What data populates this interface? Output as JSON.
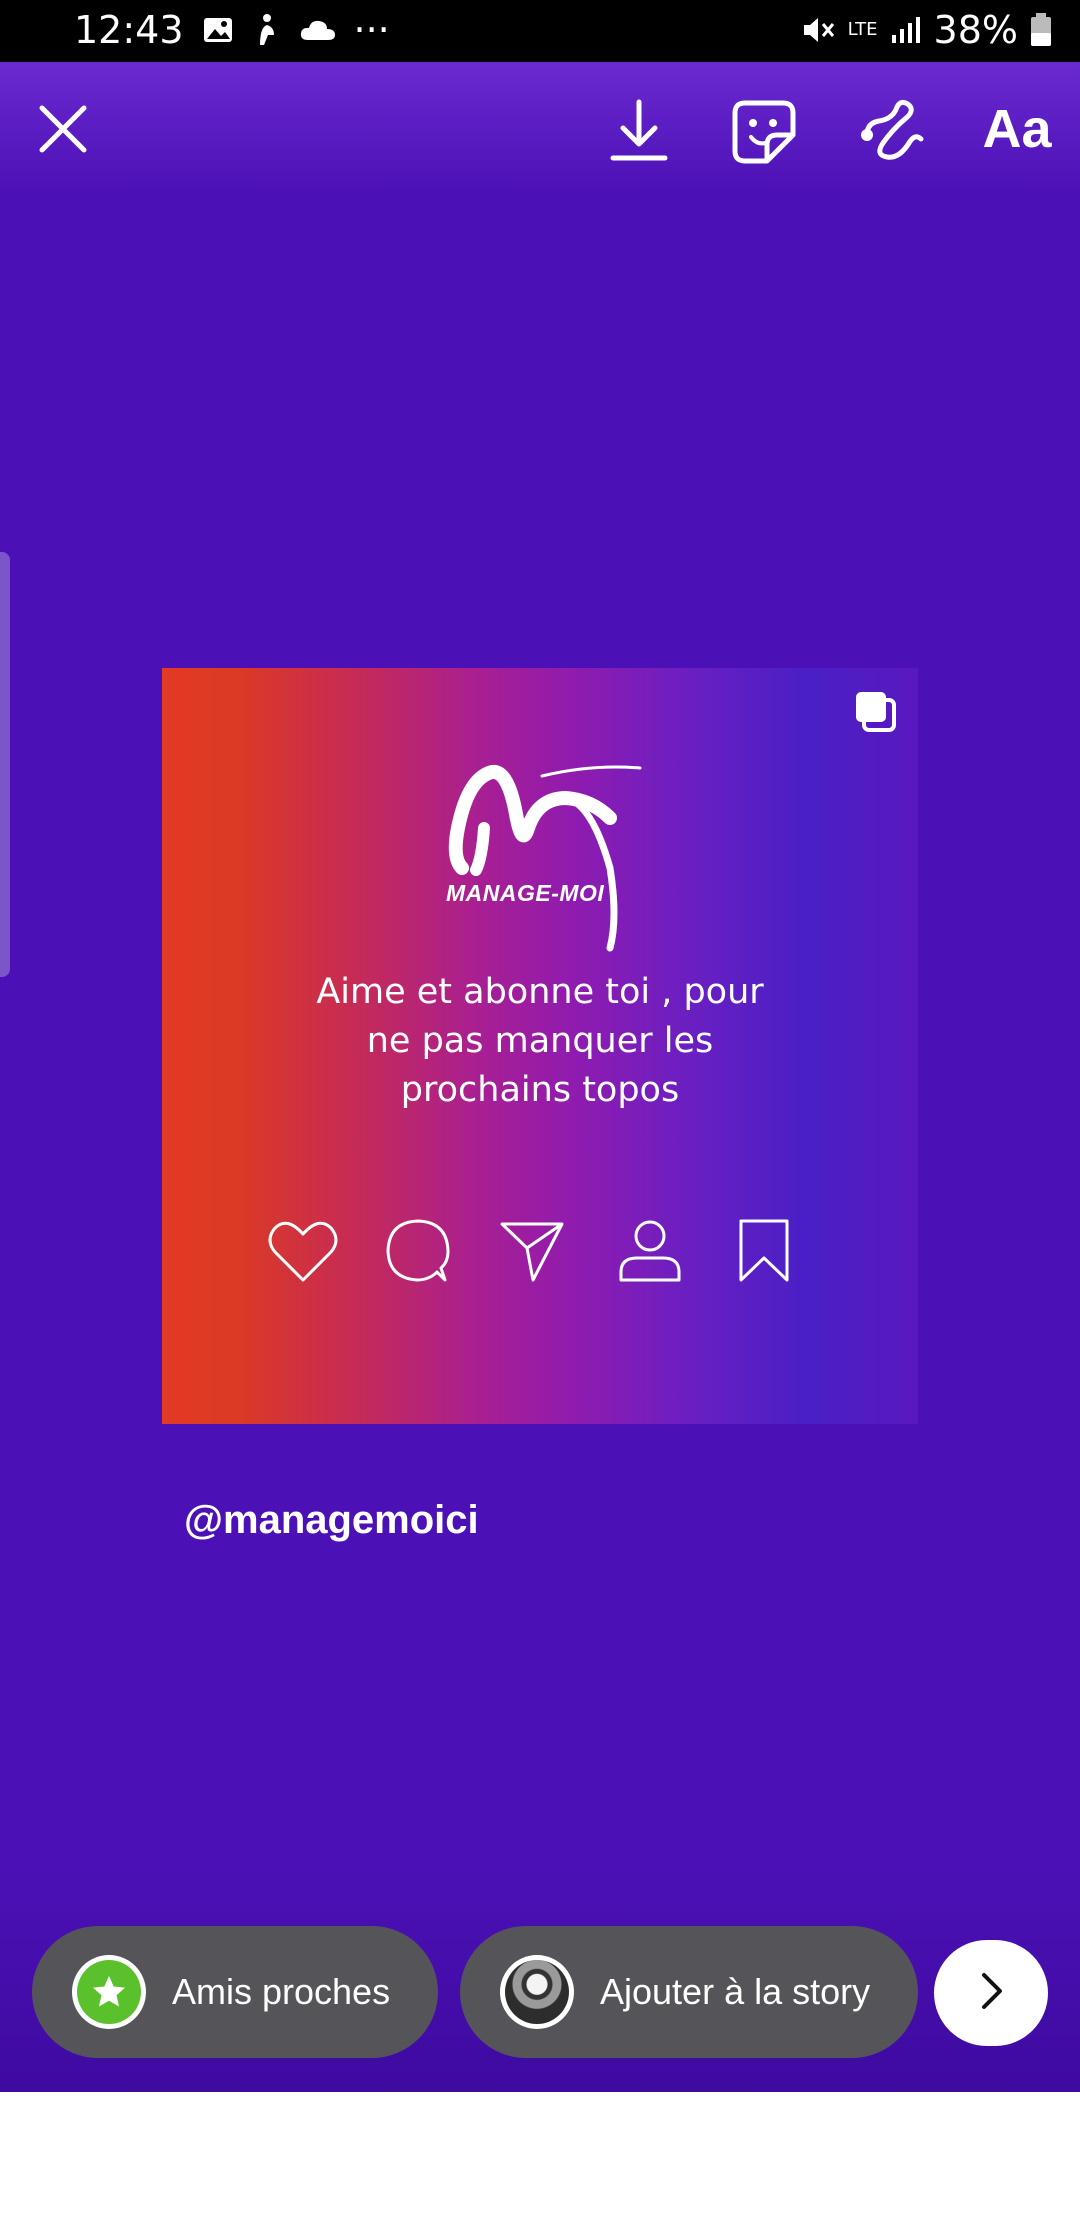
{
  "status_bar": {
    "time": "12:43",
    "more_indicator": "···",
    "network": "LTE",
    "battery": "38%",
    "icons": [
      "image-icon",
      "accessibility-icon",
      "cloud-icon",
      "mute-icon",
      "signal-icon",
      "battery-icon"
    ]
  },
  "toolbar": {
    "close_icon": "close-icon",
    "download_icon": "download-icon",
    "sticker_icon": "sticker-icon",
    "draw_icon": "draw-icon",
    "text_label": "Aa"
  },
  "post": {
    "logo_text": "MANAGE-MOI",
    "caption_lines": [
      "Aime et abonne toi , pour",
      "ne pas manquer les",
      "prochains topos"
    ],
    "action_icons": [
      "heart-icon",
      "comment-icon",
      "send-icon",
      "profile-icon",
      "bookmark-icon"
    ],
    "multi_image_icon": "carousel-icon"
  },
  "mention": "@managemoici",
  "bottom_bar": {
    "close_friends_label": "Amis proches",
    "add_story_label": "Ajouter à la story",
    "next_icon": "chevron-right-icon"
  },
  "colors": {
    "background": "#4c11b6",
    "pill": "#555559",
    "close_friends_green": "#5ac02c"
  }
}
